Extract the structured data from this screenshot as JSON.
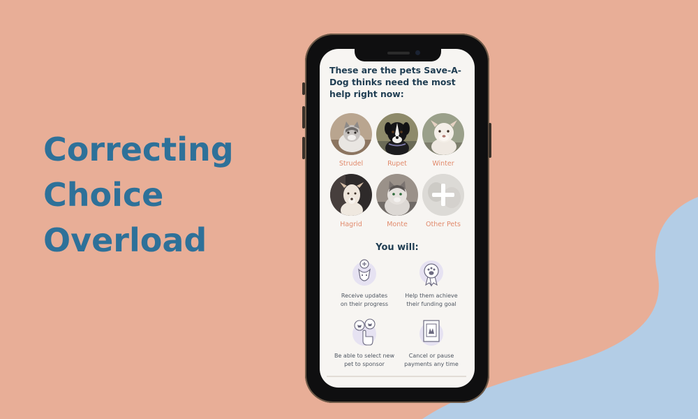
{
  "headline": {
    "lines": [
      "Correcting",
      "Choice",
      "Overload"
    ]
  },
  "screen": {
    "intro": "These are the pets Save-A-Dog thinks need the most help right now:",
    "pets": [
      {
        "name": "Strudel",
        "icon": "cat-photo"
      },
      {
        "name": "Rupet",
        "icon": "dog-photo"
      },
      {
        "name": "Winter",
        "icon": "dog-photo"
      },
      {
        "name": "Hagrid",
        "icon": "dog-photo"
      },
      {
        "name": "Monte",
        "icon": "cat-photo"
      },
      {
        "name": "Other Pets",
        "icon": "plus-icon"
      }
    ],
    "you_will": "You will:",
    "benefits": [
      {
        "text": "Receive updates\non their progress",
        "icon": "dog-update-icon"
      },
      {
        "text": "Help them achieve\ntheir funding goal",
        "icon": "paw-medal-icon"
      },
      {
        "text": "Be able to select new\npet to sponsor",
        "icon": "select-pet-icon"
      },
      {
        "text": "Cancel or pause\npayments any time",
        "icon": "frame-icon"
      }
    ]
  },
  "colors": {
    "background": "#e8ae97",
    "blob": "#b3cde6",
    "headline": "#2e7199",
    "pet_name": "#e18a6c",
    "dark_text": "#1f3d52",
    "icon_accent": "#c9c2e6"
  }
}
